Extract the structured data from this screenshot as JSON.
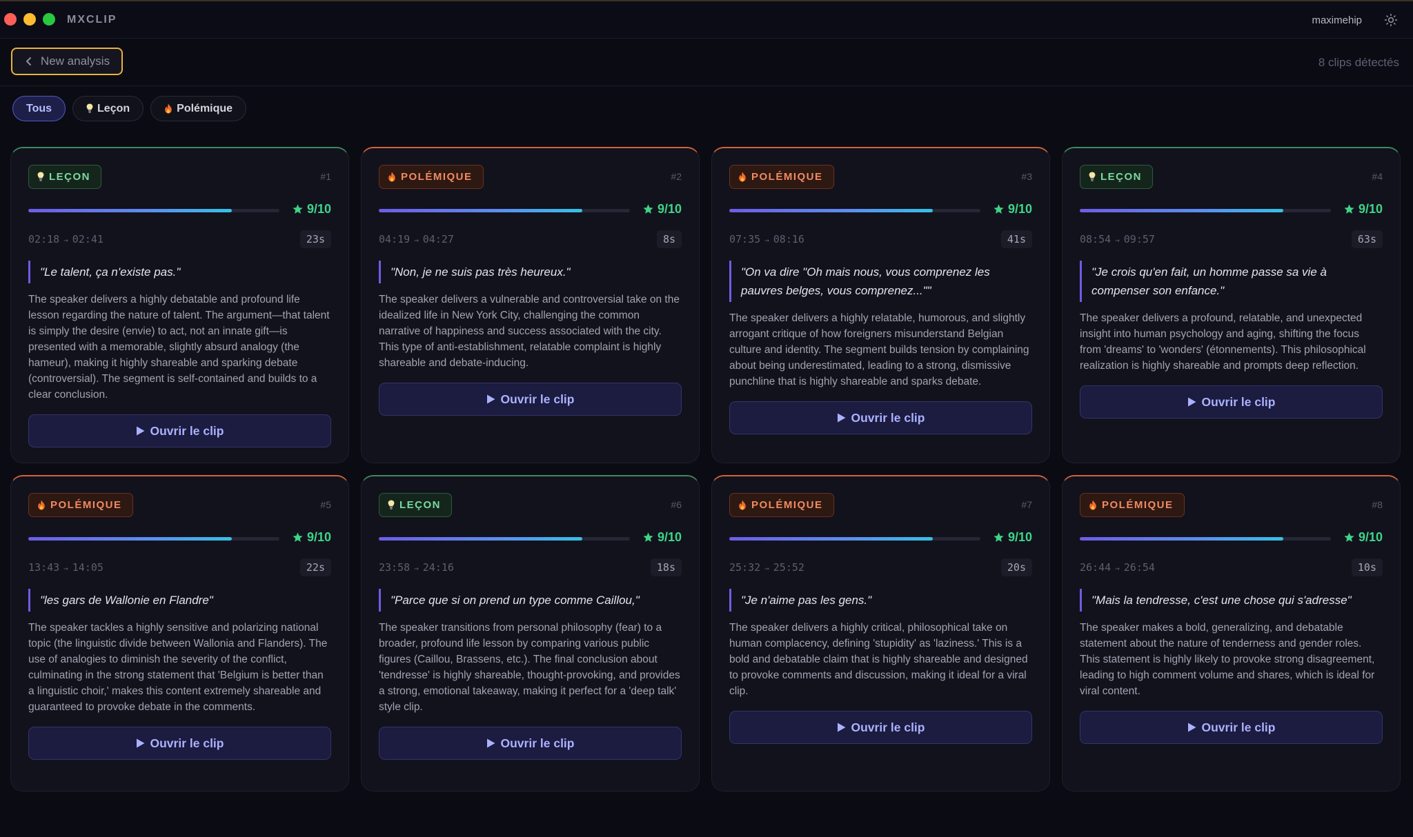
{
  "window": {
    "app_name": "MXCLIP",
    "username": "maximehip"
  },
  "toolbar": {
    "back_label": "New analysis",
    "clip_count": "8 clips détectés"
  },
  "filters": [
    {
      "label": "Tous",
      "icon": "",
      "active": true
    },
    {
      "label": "Leçon",
      "icon": "lightbulb-icon",
      "active": false
    },
    {
      "label": "Polémique",
      "icon": "flame-icon",
      "active": false
    }
  ],
  "colors": {
    "lecon": "#7cd9a0",
    "polemique": "#f08a62",
    "score": "#3ed488",
    "accent": "#6e5ce6",
    "focus": "#e8b43a"
  },
  "open_label": "Ouvrir le clip",
  "clips": [
    {
      "type": "lecon",
      "tag": "LEÇON",
      "num": "#1",
      "score_value": 9,
      "score": "9/10",
      "start": "02:18",
      "end": "02:41",
      "duration": "23s",
      "quote": "\"Le talent, ça n'existe pas.\"",
      "description": "The speaker delivers a highly debatable and profound life lesson regarding the nature of talent. The argument—that talent is simply the desire (envie) to act, not an innate gift—is presented with a memorable, slightly absurd analogy (the hameur), making it highly shareable and sparking debate (controversial). The segment is self-contained and builds to a clear conclusion."
    },
    {
      "type": "polemique",
      "tag": "POLÉMIQUE",
      "num": "#2",
      "score_value": 9,
      "score": "9/10",
      "start": "04:19",
      "end": "04:27",
      "duration": "8s",
      "quote": "\"Non, je ne suis pas très heureux.\"",
      "description": "The speaker delivers a vulnerable and controversial take on the idealized life in New York City, challenging the common narrative of happiness and success associated with the city. This type of anti-establishment, relatable complaint is highly shareable and debate-inducing."
    },
    {
      "type": "polemique",
      "tag": "POLÉMIQUE",
      "num": "#3",
      "score_value": 9,
      "score": "9/10",
      "start": "07:35",
      "end": "08:16",
      "duration": "41s",
      "quote": "\"On va dire \"Oh mais nous, vous comprenez les pauvres belges, vous comprenez...\"\"",
      "description": "The speaker delivers a highly relatable, humorous, and slightly arrogant critique of how foreigners misunderstand Belgian culture and identity. The segment builds tension by complaining about being underestimated, leading to a strong, dismissive punchline that is highly shareable and sparks debate."
    },
    {
      "type": "lecon",
      "tag": "LEÇON",
      "num": "#4",
      "score_value": 9,
      "score": "9/10",
      "start": "08:54",
      "end": "09:57",
      "duration": "63s",
      "quote": "\"Je crois qu'en fait, un homme passe sa vie à compenser son enfance.\"",
      "description": "The speaker delivers a profound, relatable, and unexpected insight into human psychology and aging, shifting the focus from 'dreams' to 'wonders' (étonnements). This philosophical realization is highly shareable and prompts deep reflection."
    },
    {
      "type": "polemique",
      "tag": "POLÉMIQUE",
      "num": "#5",
      "score_value": 9,
      "score": "9/10",
      "start": "13:43",
      "end": "14:05",
      "duration": "22s",
      "quote": "\"les gars de Wallonie en Flandre\"",
      "description": "The speaker tackles a highly sensitive and polarizing national topic (the linguistic divide between Wallonia and Flanders). The use of analogies to diminish the severity of the conflict, culminating in the strong statement that 'Belgium is better than a linguistic choir,' makes this content extremely shareable and guaranteed to provoke debate in the comments."
    },
    {
      "type": "lecon",
      "tag": "LEÇON",
      "num": "#6",
      "score_value": 9,
      "score": "9/10",
      "start": "23:58",
      "end": "24:16",
      "duration": "18s",
      "quote": "\"Parce que si on prend un type comme Caillou,\"",
      "description": "The speaker transitions from personal philosophy (fear) to a broader, profound life lesson by comparing various public figures (Caillou, Brassens, etc.). The final conclusion about 'tendresse' is highly shareable, thought-provoking, and provides a strong, emotional takeaway, making it perfect for a 'deep talk' style clip."
    },
    {
      "type": "polemique",
      "tag": "POLÉMIQUE",
      "num": "#7",
      "score_value": 9,
      "score": "9/10",
      "start": "25:32",
      "end": "25:52",
      "duration": "20s",
      "quote": "\"Je n'aime pas les gens.\"",
      "description": "The speaker delivers a highly critical, philosophical take on human complacency, defining 'stupidity' as 'laziness.' This is a bold and debatable claim that is highly shareable and designed to provoke comments and discussion, making it ideal for a viral clip."
    },
    {
      "type": "polemique",
      "tag": "POLÉMIQUE",
      "num": "#8",
      "score_value": 9,
      "score": "9/10",
      "start": "26:44",
      "end": "26:54",
      "duration": "10s",
      "quote": "\"Mais la tendresse, c'est une chose qui s'adresse\"",
      "description": "The speaker makes a bold, generalizing, and debatable statement about the nature of tenderness and gender roles. This statement is highly likely to provoke strong disagreement, leading to high comment volume and shares, which is ideal for viral content."
    }
  ]
}
